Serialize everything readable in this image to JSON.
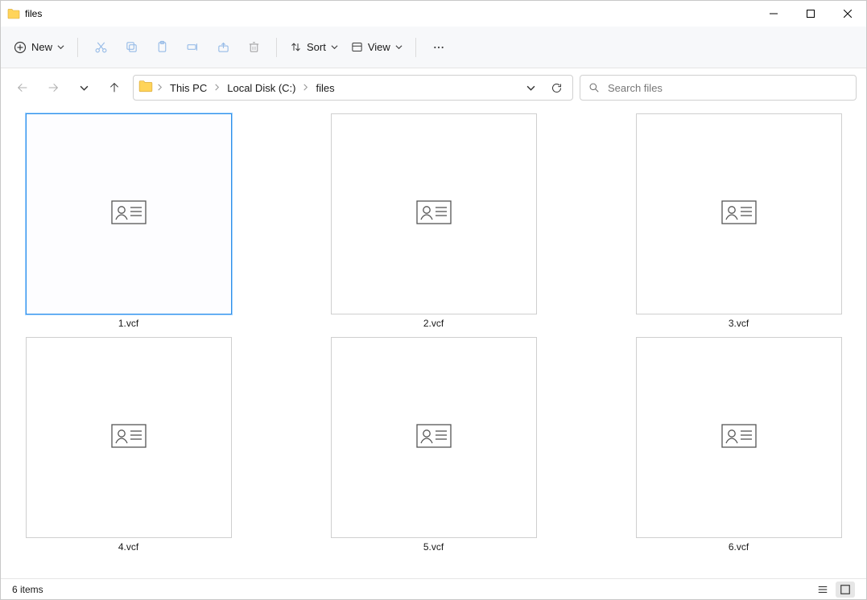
{
  "window": {
    "title": "files"
  },
  "toolbar": {
    "new_label": "New",
    "sort_label": "Sort",
    "view_label": "View"
  },
  "breadcrumb": {
    "segments": [
      "This PC",
      "Local Disk (C:)",
      "files"
    ]
  },
  "search": {
    "placeholder": "Search files"
  },
  "files": [
    {
      "name": "1.vcf",
      "selected": true
    },
    {
      "name": "2.vcf",
      "selected": false
    },
    {
      "name": "3.vcf",
      "selected": false
    },
    {
      "name": "4.vcf",
      "selected": false
    },
    {
      "name": "5.vcf",
      "selected": false
    },
    {
      "name": "6.vcf",
      "selected": false
    }
  ],
  "status": {
    "item_count": "6 items"
  }
}
